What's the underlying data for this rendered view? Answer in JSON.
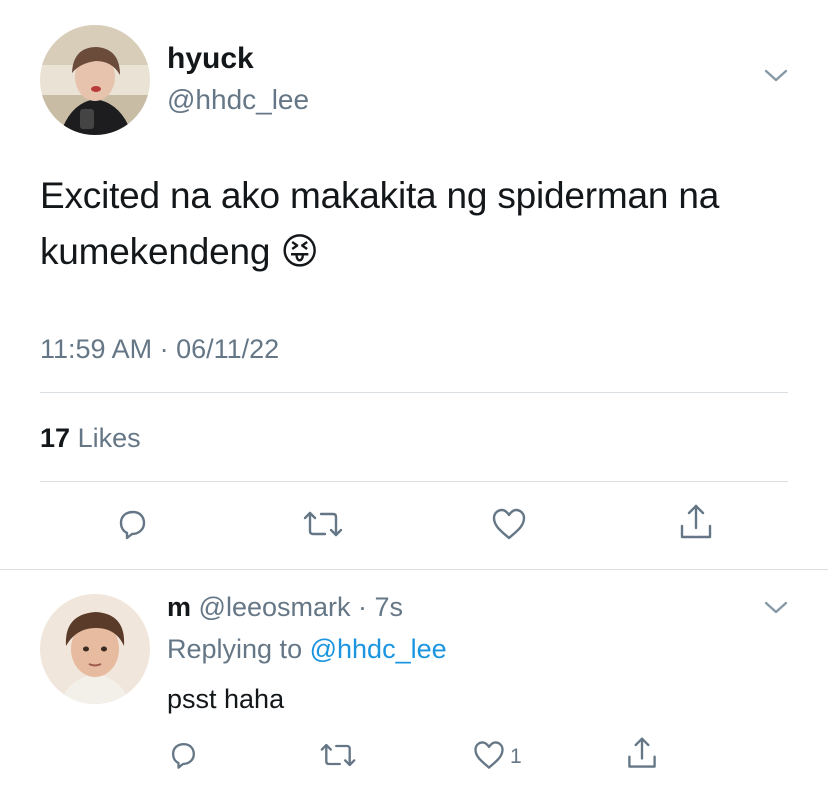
{
  "tweet": {
    "author_name": "hyuck",
    "author_handle": "@hhdc_lee",
    "text": "Excited na ako makakita ng spiderman na kumekendeng 😝",
    "timestamp": "11:59 AM · 06/11/22",
    "likes_count": "17",
    "likes_label": "Likes"
  },
  "reply": {
    "author_name": "m",
    "author_handle": "@leeosmark",
    "time_ago": "7s",
    "replying_label": "Replying to",
    "replying_handle": "@hhdc_lee",
    "text": "psst haha",
    "like_count": "1"
  },
  "colors": {
    "link": "#1b95e0",
    "muted": "#657786",
    "divider": "#d9dee2"
  },
  "icons": [
    "chevron-down-icon",
    "reply-icon",
    "retweet-icon",
    "like-icon",
    "share-icon"
  ]
}
